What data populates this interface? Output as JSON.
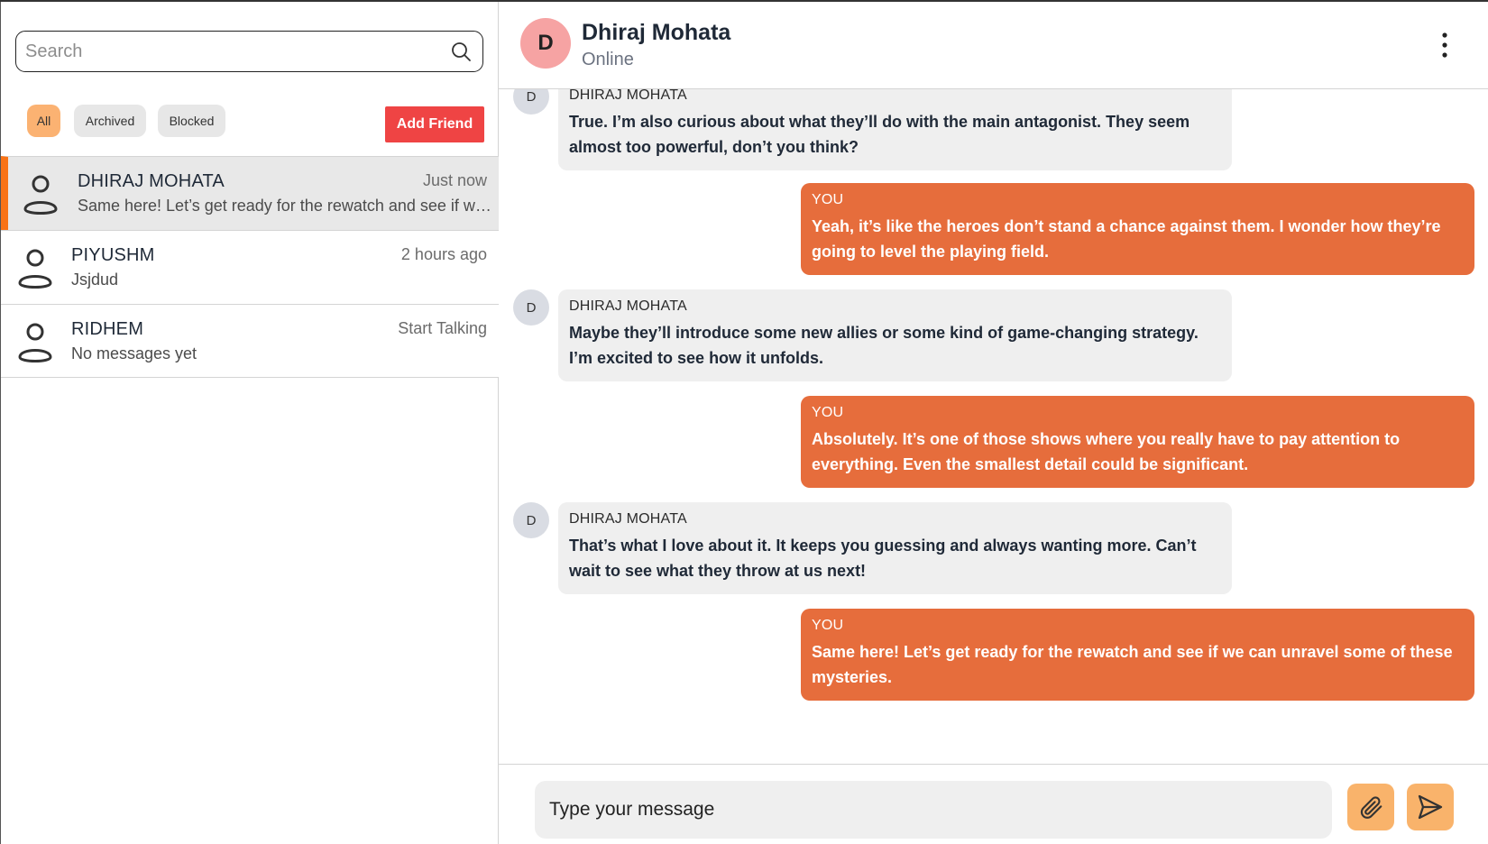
{
  "search": {
    "placeholder": "Search"
  },
  "filters": {
    "all": "All",
    "archived": "Archived",
    "blocked": "Blocked"
  },
  "add_friend_label": "Add Friend",
  "conversations": [
    {
      "name": "DHIRAJ MOHATA",
      "time": "Just now",
      "preview": "Same here! Let’s get ready for the rewatch and see if we can unravel some of these mysteries.",
      "active": true
    },
    {
      "name": "PIYUSHM",
      "time": "2 hours ago",
      "preview": "Jsjdud",
      "active": false
    },
    {
      "name": "RIDHEM",
      "time": "Start Talking",
      "preview": "No messages yet",
      "active": false
    }
  ],
  "chat": {
    "contact_name": "Dhiraj Mohata",
    "contact_initial": "D",
    "status": "Online",
    "composer_placeholder": "Type your message"
  },
  "messages": [
    {
      "from": "DHIRAJ MOHATA",
      "initial": "D",
      "outgoing": false,
      "text": "True. I’m also curious about what they’ll do with the main antagonist. They seem almost too powerful, don’t you think?"
    },
    {
      "from": "YOU",
      "outgoing": true,
      "text": "Yeah, it’s like the heroes don’t stand a chance against them. I wonder how they’re going to level the playing field."
    },
    {
      "from": "DHIRAJ MOHATA",
      "initial": "D",
      "outgoing": false,
      "text": "Maybe they’ll introduce some new allies or some kind of game-changing strategy. I’m excited to see how it unfolds."
    },
    {
      "from": "YOU",
      "outgoing": true,
      "text": "Absolutely. It’s one of those shows where you really have to pay attention to everything. Even the smallest detail could be significant."
    },
    {
      "from": "DHIRAJ MOHATA",
      "initial": "D",
      "outgoing": false,
      "text": "That’s what I love about it. It keeps you guessing and always wanting more. Can’t wait to see what they throw at us next!"
    },
    {
      "from": "YOU",
      "outgoing": true,
      "text": "Same here! Let’s get ready for the rewatch and see if we can unravel some of these mysteries."
    }
  ],
  "colors": {
    "accent": "#f97316",
    "outgoing_bubble": "#e66d3c",
    "incoming_bubble": "#efefef",
    "add_friend": "#ef4444",
    "chip_active": "#fbb272",
    "icon_button": "#f9b36b"
  },
  "icons": [
    "search-icon",
    "person-icon",
    "kebab-menu-icon",
    "paperclip-icon",
    "send-icon"
  ]
}
